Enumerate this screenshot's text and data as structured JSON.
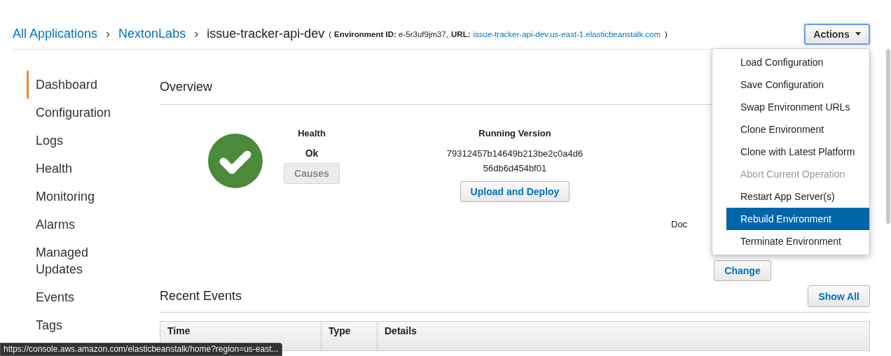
{
  "breadcrumb": [
    {
      "label": "All Applications",
      "kind": "link"
    },
    {
      "label": "NextonLabs",
      "kind": "link"
    },
    {
      "label": "issue-tracker-api-dev",
      "kind": "current"
    }
  ],
  "breadcrumb_separators": [
    "›",
    "›"
  ],
  "environment_info": {
    "open": "(",
    "close": ")",
    "id_label": "Environment ID:",
    "id": "e-5r3uf9jm37,",
    "url_label": "URL:",
    "url": "issue-tracker-api-dev.us-east-1.elasticbeanstalk.com"
  },
  "actions_button": {
    "label": "Actions",
    "expanded": true
  },
  "actions_menu": [
    {
      "label": "Load Configuration",
      "disabled": false,
      "selected": false
    },
    {
      "label": "Save Configuration",
      "disabled": false,
      "selected": false
    },
    {
      "label": "Swap Environment URLs",
      "disabled": false,
      "selected": false
    },
    {
      "label": "Clone Environment",
      "disabled": false,
      "selected": false
    },
    {
      "label": "Clone with Latest Platform",
      "disabled": false,
      "selected": false
    },
    {
      "label": "Abort Current Operation",
      "disabled": true,
      "selected": false
    },
    {
      "label": "Restart App Server(s)",
      "disabled": false,
      "selected": false
    },
    {
      "label": "Rebuild Environment",
      "disabled": false,
      "selected": true
    },
    {
      "label": "Terminate Environment",
      "disabled": false,
      "selected": false
    }
  ],
  "sidebar": {
    "items": [
      {
        "label": "Dashboard",
        "selected": true
      },
      {
        "label": "Configuration",
        "selected": false
      },
      {
        "label": "Logs",
        "selected": false
      },
      {
        "label": "Health",
        "selected": false
      },
      {
        "label": "Monitoring",
        "selected": false
      },
      {
        "label": "Alarms",
        "selected": false
      },
      {
        "label": "Managed Updates",
        "selected": false
      },
      {
        "label": "Events",
        "selected": false
      },
      {
        "label": "Tags",
        "selected": false
      }
    ]
  },
  "overview": {
    "title": "Overview",
    "health": {
      "label": "Health",
      "status": "Ok",
      "button": {
        "label": "Causes",
        "disabled": true
      }
    },
    "running_version": {
      "label": "Running Version",
      "lines": [
        "79312457b14649b213be2c0a4d6",
        "56db6d454bf01"
      ],
      "button": {
        "label": "Upload and Deploy",
        "disabled": false
      }
    },
    "platform": {
      "text": "Doc",
      "button": {
        "label": "Change",
        "disabled": false
      }
    }
  },
  "recent_events": {
    "title": "Recent Events",
    "button": "Show All",
    "table": {
      "columns": [
        "Time",
        "Type",
        "Details"
      ]
    }
  },
  "status_url": "https://console.aws.amazon.com/elasticbeanstalk/home?region=us-east..."
}
